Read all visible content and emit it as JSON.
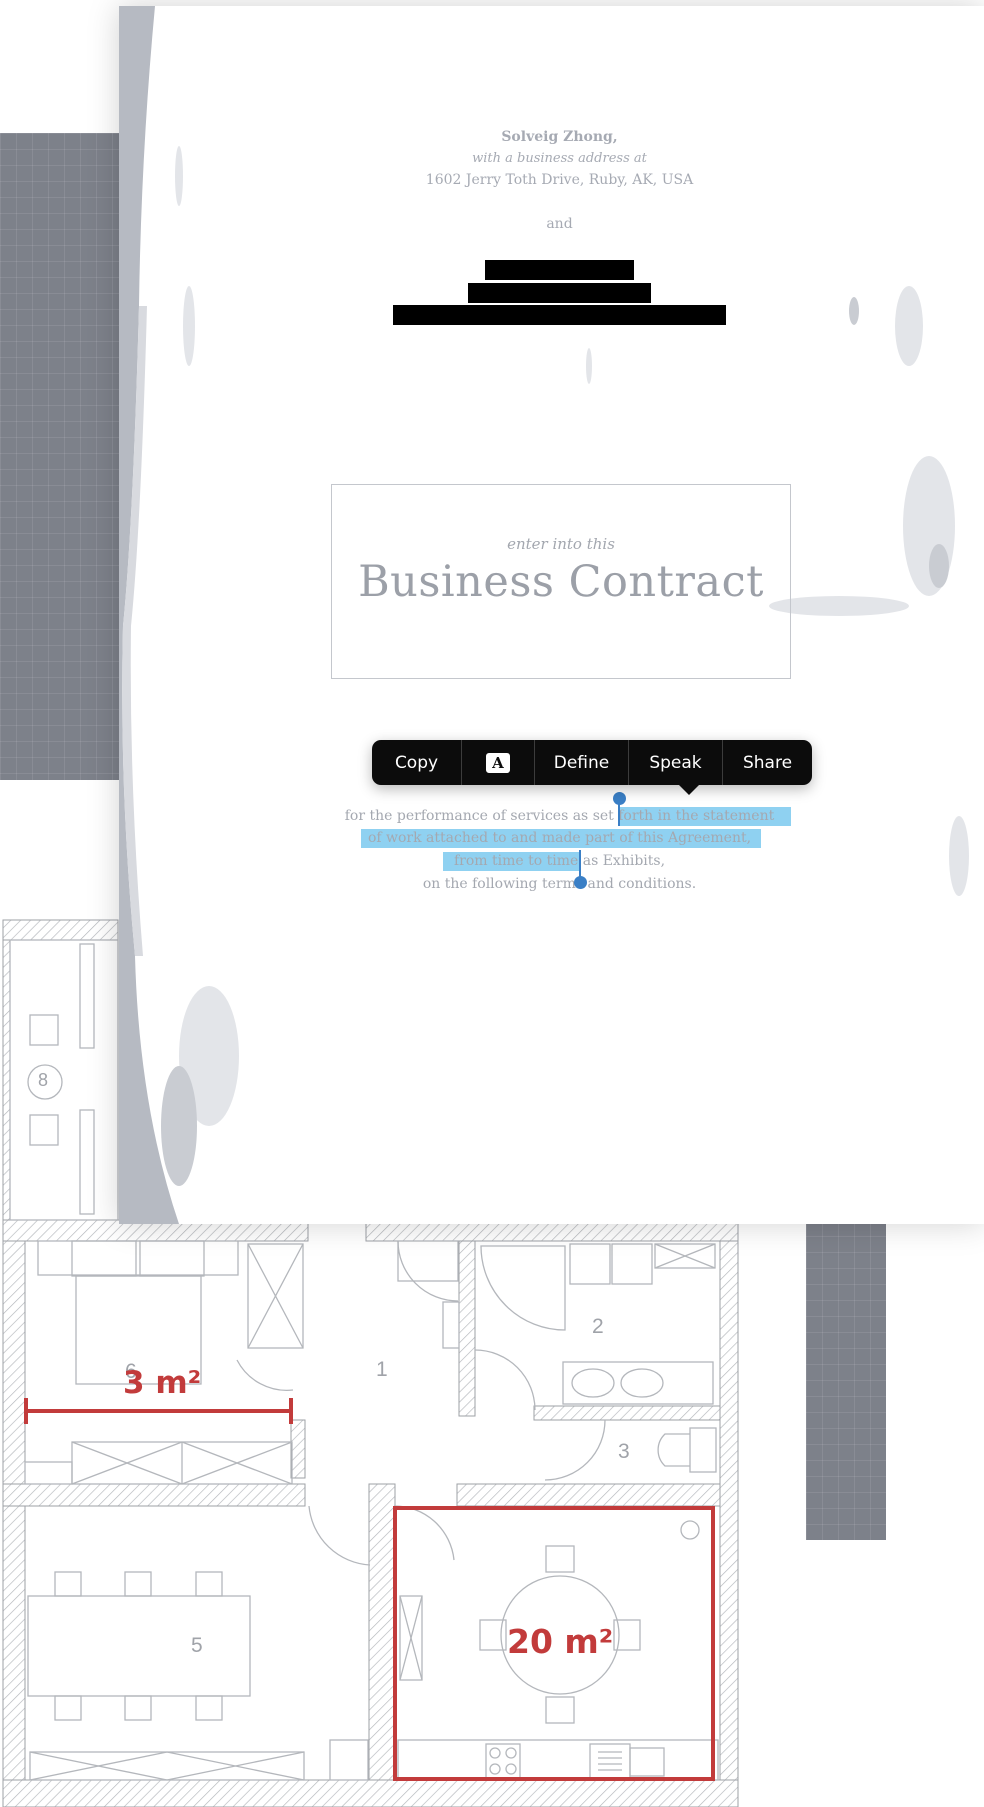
{
  "document": {
    "party_one_name": "Solveig Zhong,",
    "party_one_intro": "with a business address at",
    "party_one_address": "1602 Jerry Toth Drive, Ruby, AK, USA",
    "conjunction": "and",
    "title_kicker": "enter into this",
    "title": "Business Contract",
    "body": {
      "line1_plain": "for the performance of services as set",
      "line1_selected": "forth in the statement",
      "line2_selected": "of work attached to and made part of this Agreement,",
      "line3_selected": "from time to time",
      "line3_plain": "as Exhibits,",
      "line4_plain": "on the following terms and conditions."
    }
  },
  "context_menu": {
    "copy": "Copy",
    "font_glyph": "A",
    "define": "Define",
    "speak": "Speak",
    "share": "Share"
  },
  "floorplan": {
    "room_labels": [
      "1",
      "2",
      "3",
      "5",
      "6",
      "8"
    ],
    "area_label_small": "3 m²",
    "area_label_large": "20 m²"
  },
  "colors": {
    "selection": "#8fd1f1",
    "selection_handle": "#3a7fc6",
    "measure_red": "#c23b3b",
    "menu_background": "#0c0c0c",
    "grid_panel": "#7d818a"
  }
}
